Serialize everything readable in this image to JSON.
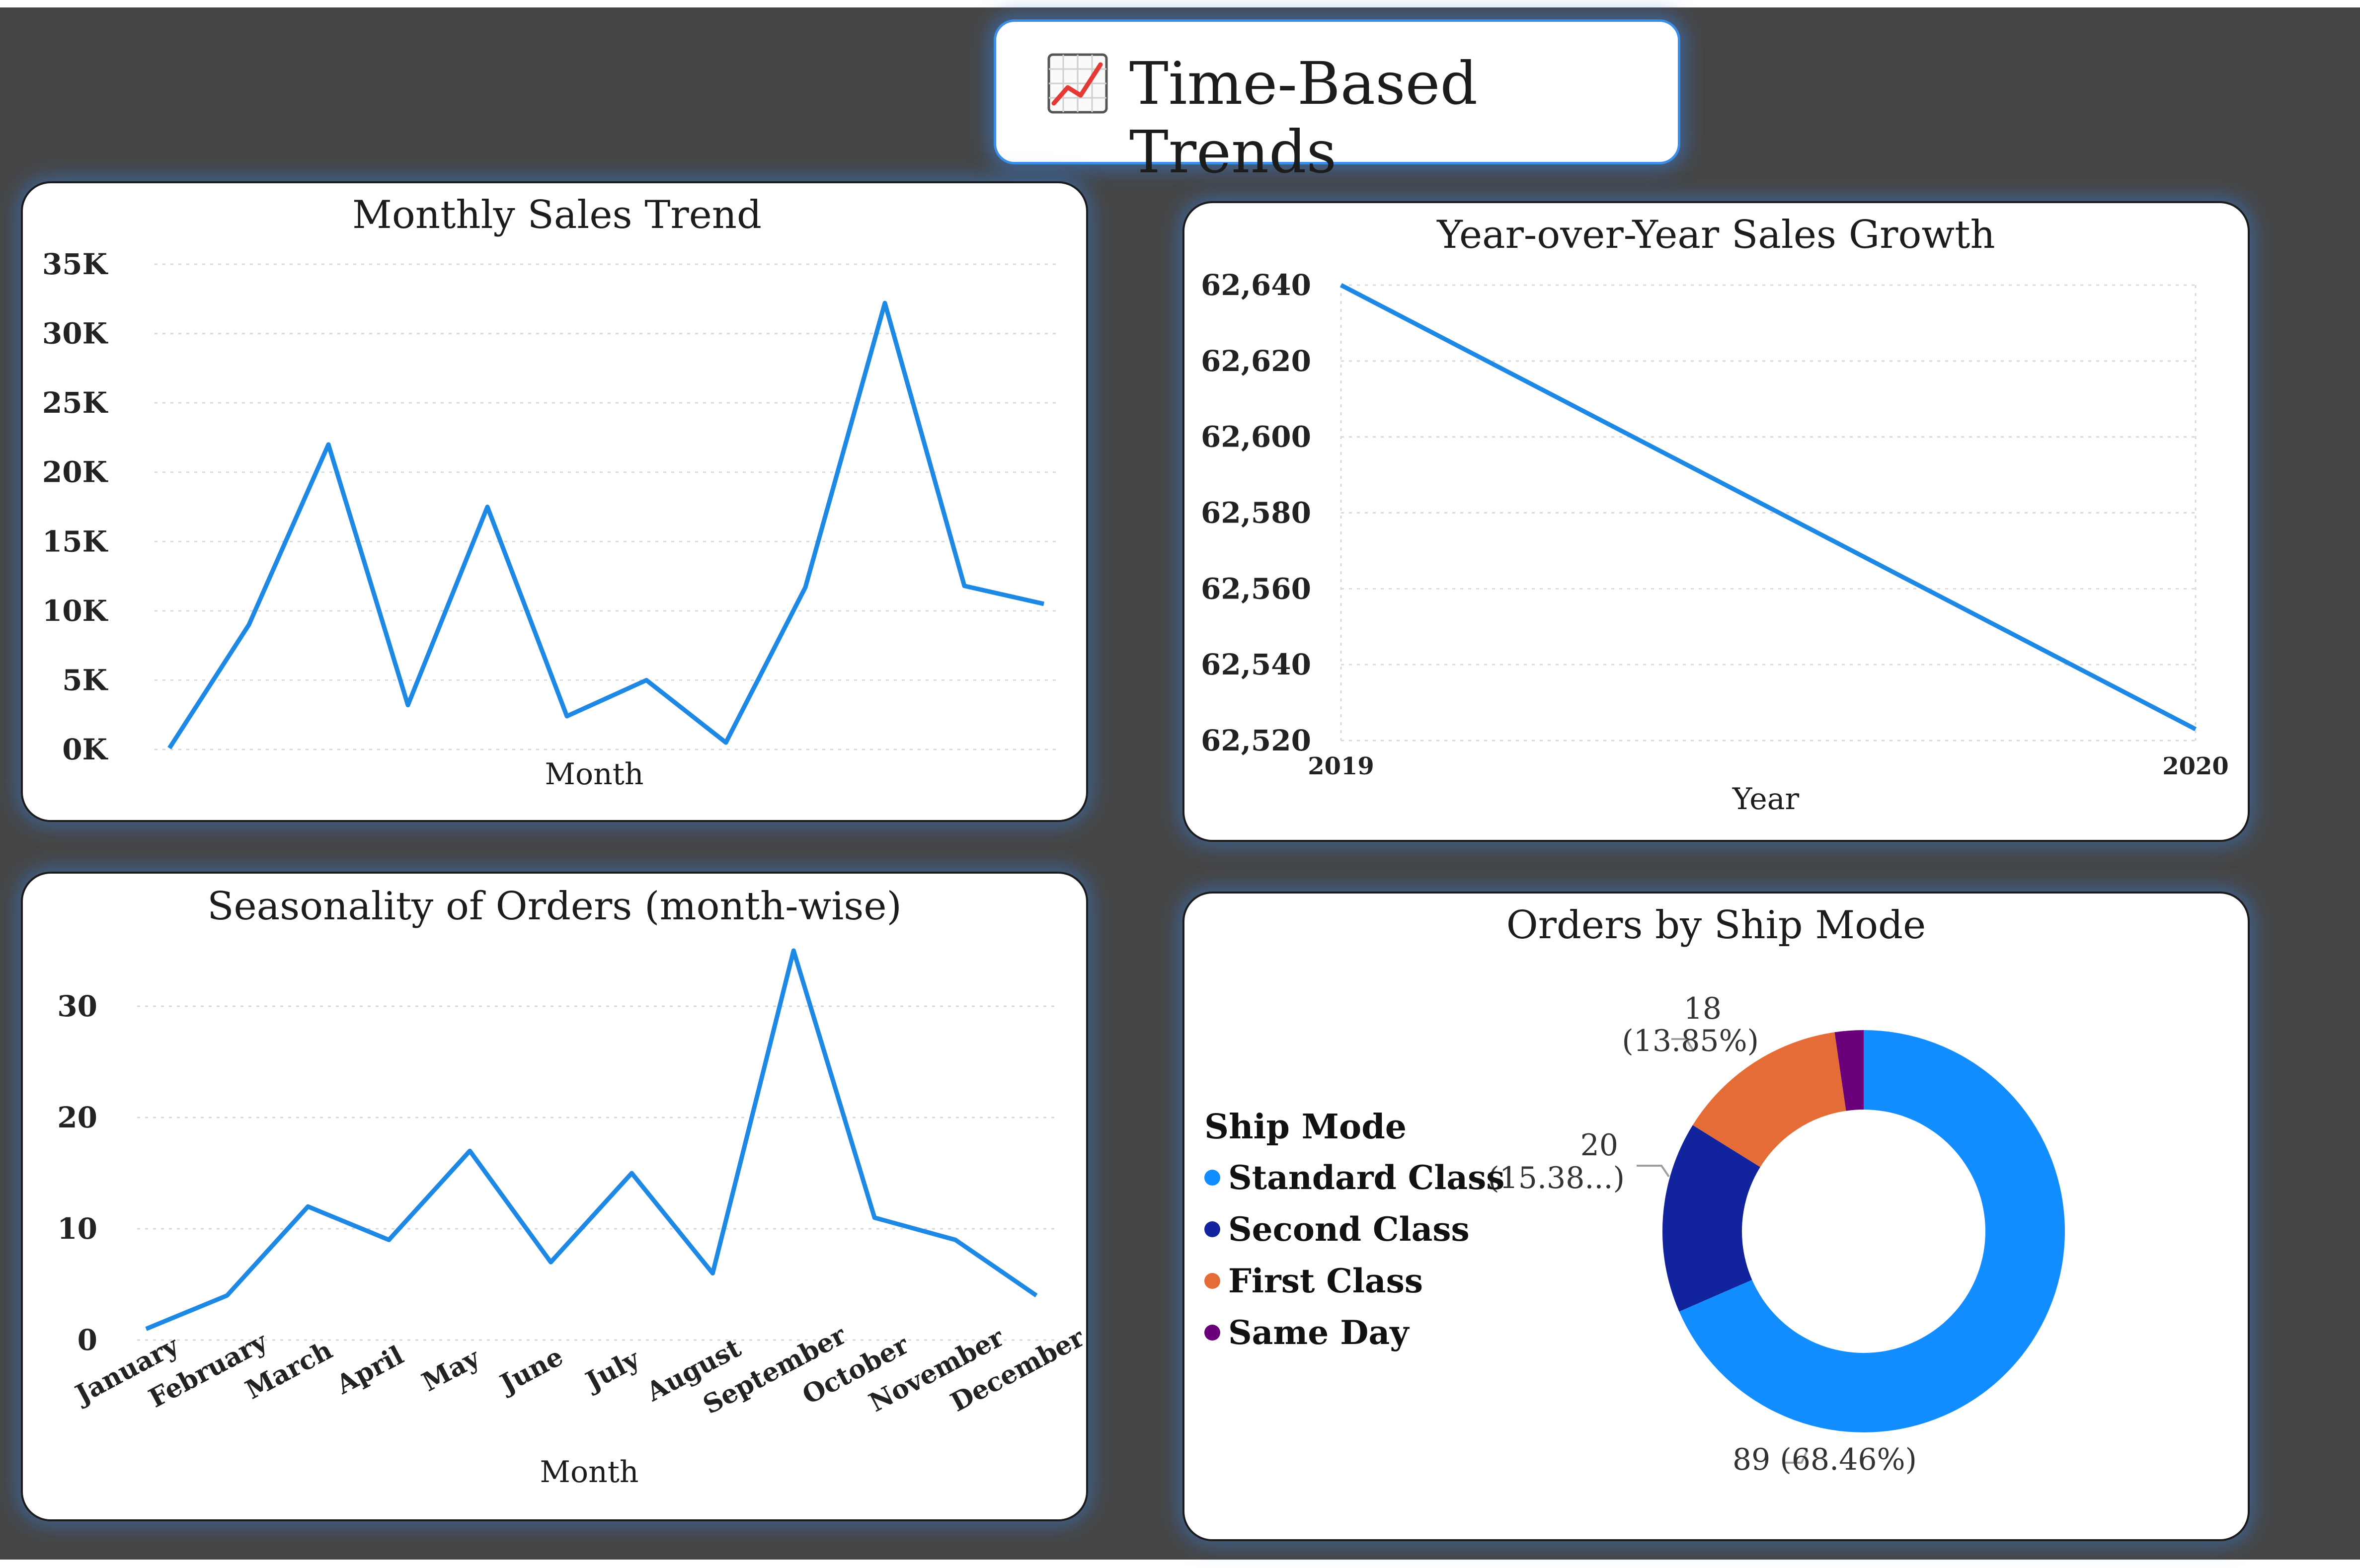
{
  "header": {
    "title": "Time-Based Trends",
    "icon": "chart-increasing-icon"
  },
  "colors": {
    "line": "#1e88e5",
    "grid": "#d9d9d9",
    "background": "#454545"
  },
  "chart_data": [
    {
      "id": "monthly_sales",
      "type": "line",
      "title": "Monthly Sales Trend",
      "xlabel": "Month",
      "ylabel": "",
      "ylim": [
        0,
        35000
      ],
      "yticks": [
        "0K",
        "5K",
        "10K",
        "15K",
        "20K",
        "25K",
        "30K",
        "35K"
      ],
      "x": [
        1,
        2,
        3,
        4,
        5,
        6,
        7,
        8,
        9,
        10,
        11,
        12
      ],
      "values": [
        100,
        9000,
        22000,
        3200,
        17500,
        2400,
        5000,
        500,
        11700,
        32200,
        11800,
        10500
      ],
      "grid": true
    },
    {
      "id": "yoy_growth",
      "type": "line",
      "title": "Year-over-Year Sales Growth",
      "xlabel": "Year",
      "ylabel": "",
      "categories": [
        "2019",
        "2020"
      ],
      "values": [
        62640,
        62523
      ],
      "ylim": [
        62520,
        62640
      ],
      "yticks": [
        "62,520",
        "62,540",
        "62,560",
        "62,580",
        "62,600",
        "62,620",
        "62,640"
      ],
      "grid": true
    },
    {
      "id": "seasonality",
      "type": "line",
      "title": "Seasonality of Orders (month-wise)",
      "xlabel": "Month",
      "ylabel": "",
      "categories": [
        "January",
        "February",
        "March",
        "April",
        "May",
        "June",
        "July",
        "August",
        "September",
        "October",
        "November",
        "December"
      ],
      "values": [
        1,
        4,
        12,
        9,
        17,
        7,
        15,
        6,
        35,
        11,
        9,
        4
      ],
      "ylim": [
        0,
        35
      ],
      "yticks": [
        "0",
        "10",
        "20",
        "30"
      ],
      "grid": true
    },
    {
      "id": "ship_mode",
      "type": "pie",
      "title": "Orders by Ship Mode",
      "legend_title": "Ship Mode",
      "legend_position": "left",
      "categories": [
        "Standard Class",
        "Second Class",
        "First Class",
        "Same Day"
      ],
      "values": [
        89,
        20,
        18,
        3
      ],
      "colors": [
        "#118dff",
        "#12239e",
        "#e66c37",
        "#6b007b"
      ],
      "labels": {
        "standard": "89 (68.46%)",
        "second_value": "20",
        "second_pct": "(15.38...)",
        "first_value": "18",
        "first_pct": "(13.85%)"
      }
    }
  ]
}
